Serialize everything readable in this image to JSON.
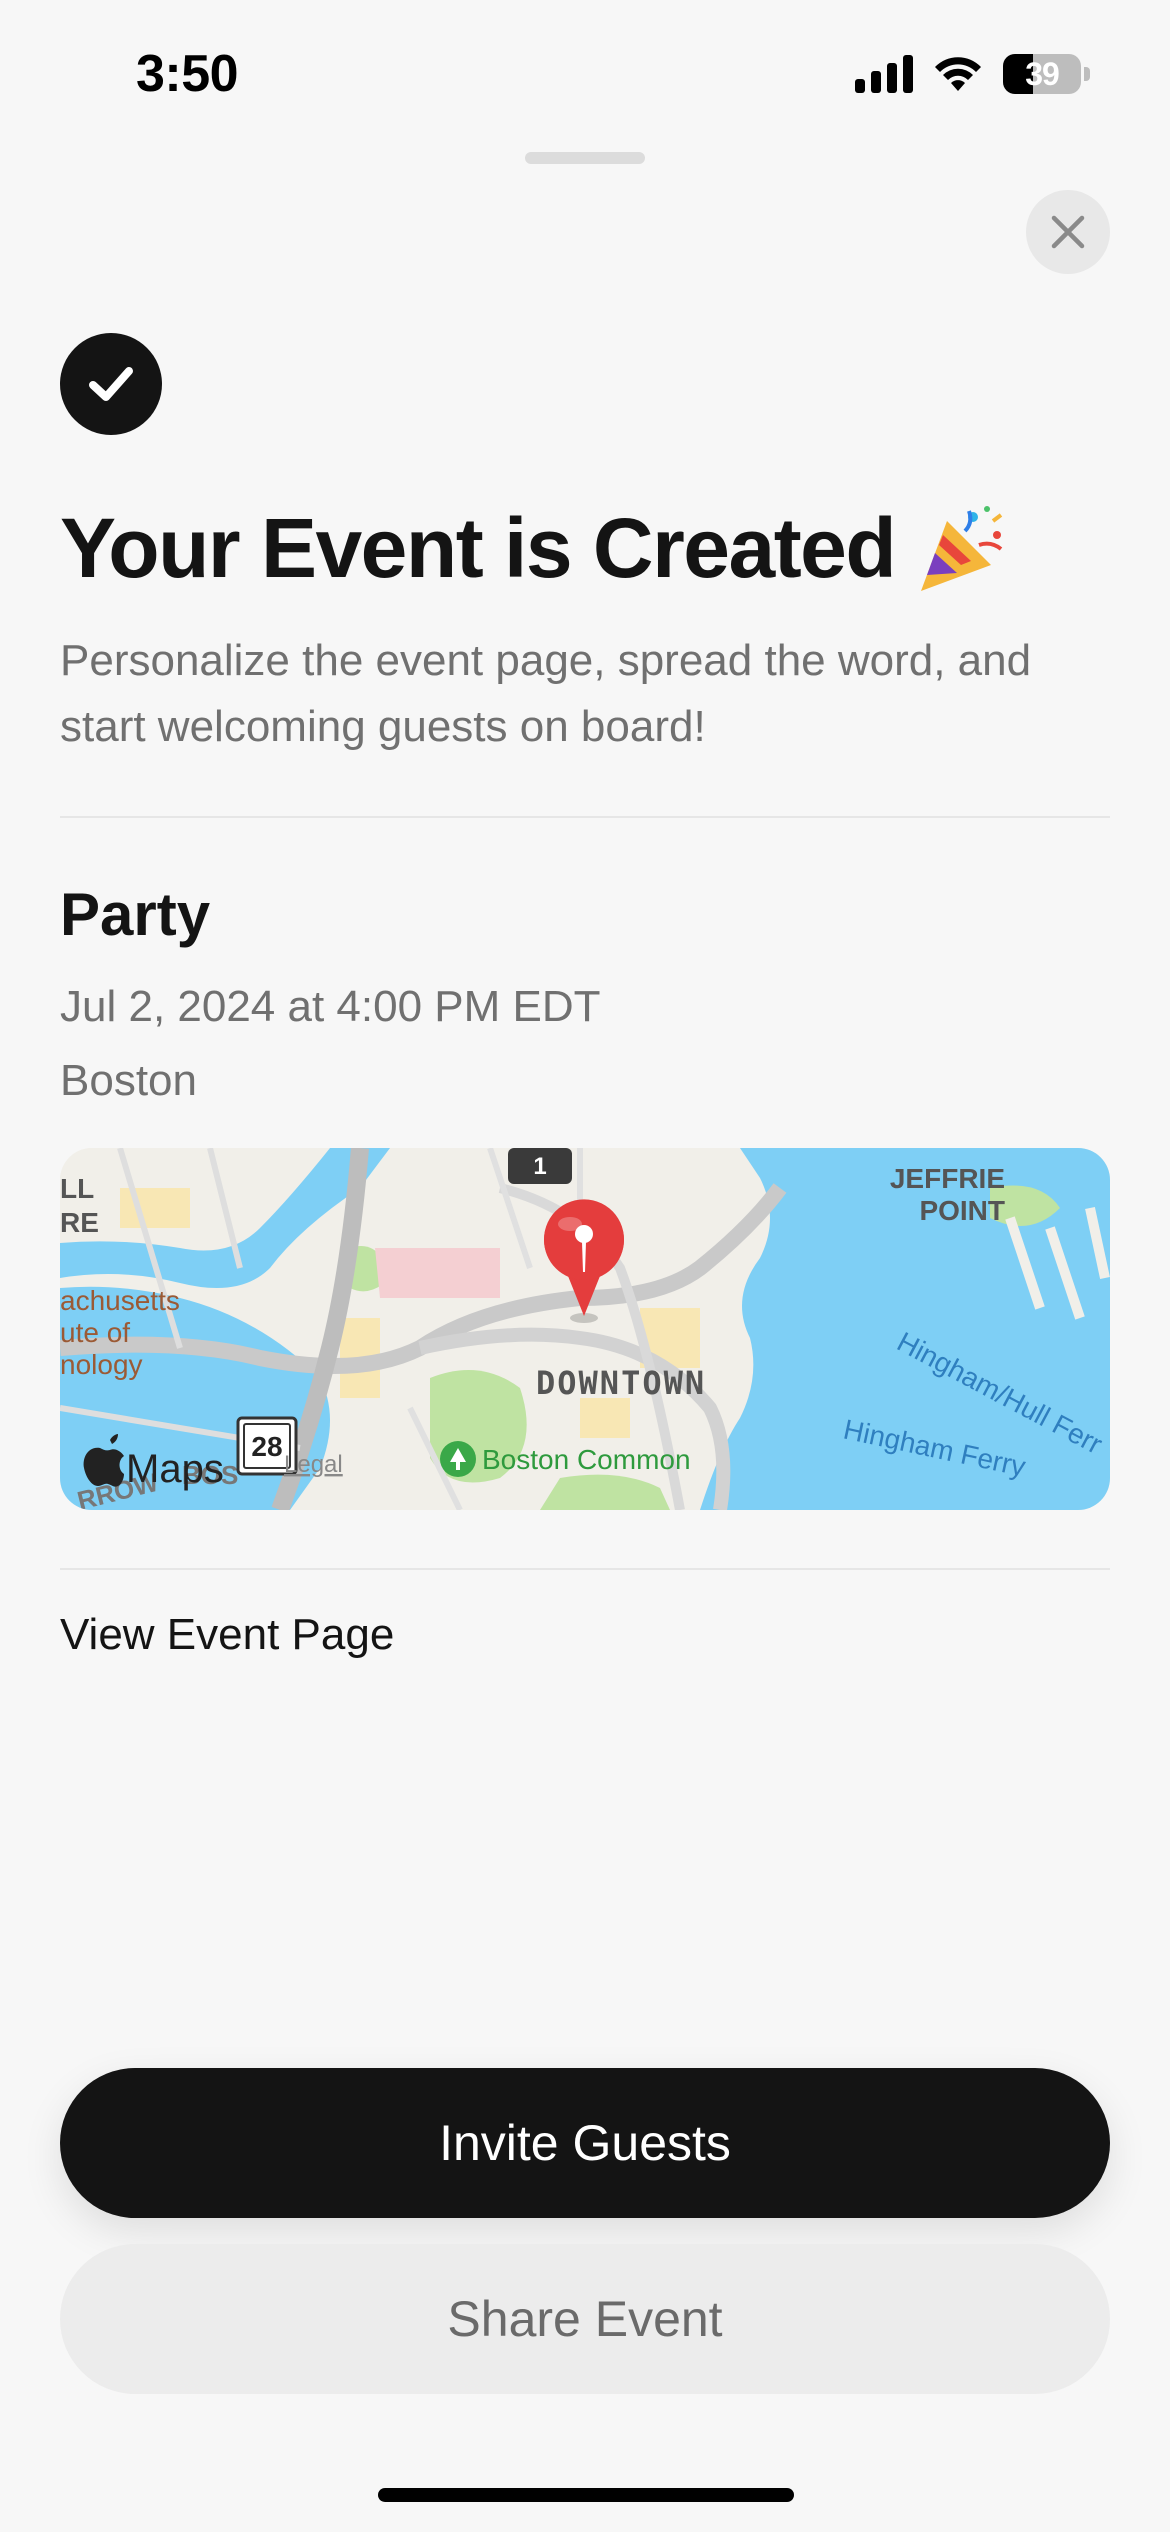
{
  "status_bar": {
    "time": "3:50",
    "battery": "39"
  },
  "header": {
    "headline": "Your Event is Created",
    "subtitle": "Personalize the event page, spread the word, and start welcoming guests on board!"
  },
  "event": {
    "name": "Party",
    "datetime": "Jul 2, 2024 at 4:00 PM EDT",
    "location": "Boston"
  },
  "map": {
    "labels": {
      "downtown": "DOWNTOWN",
      "boston_common": "Boston Common",
      "jeffries_1": "JEFFRIE",
      "jeffries_2": "POINT",
      "mass_1": "achusetts",
      "mass_2": "ute of",
      "mass_3": "nology",
      "ferry_1": "Hingham/Hull Ferr",
      "ferry_2": "Hingham Ferry",
      "route_28": "28",
      "route_1": "1",
      "maps_brand": "Maps",
      "legal": "Legal",
      "ll": "LL",
      "re": "RE",
      "row": "RROW",
      "bos": "BOS"
    },
    "colors": {
      "water": "#7ecff5",
      "land": "#f1efe9",
      "park": "#bfe3a2",
      "pin": "#e43d3d"
    }
  },
  "links": {
    "view_event_page": "View Event Page"
  },
  "actions": {
    "invite": "Invite Guests",
    "share": "Share Event"
  },
  "icons": [
    "cellular-signal-icon",
    "wifi-icon",
    "battery-icon",
    "close-icon",
    "checkmark-icon",
    "party-popper-icon",
    "map-pin-icon",
    "apple-logo-icon",
    "park-tree-icon"
  ]
}
